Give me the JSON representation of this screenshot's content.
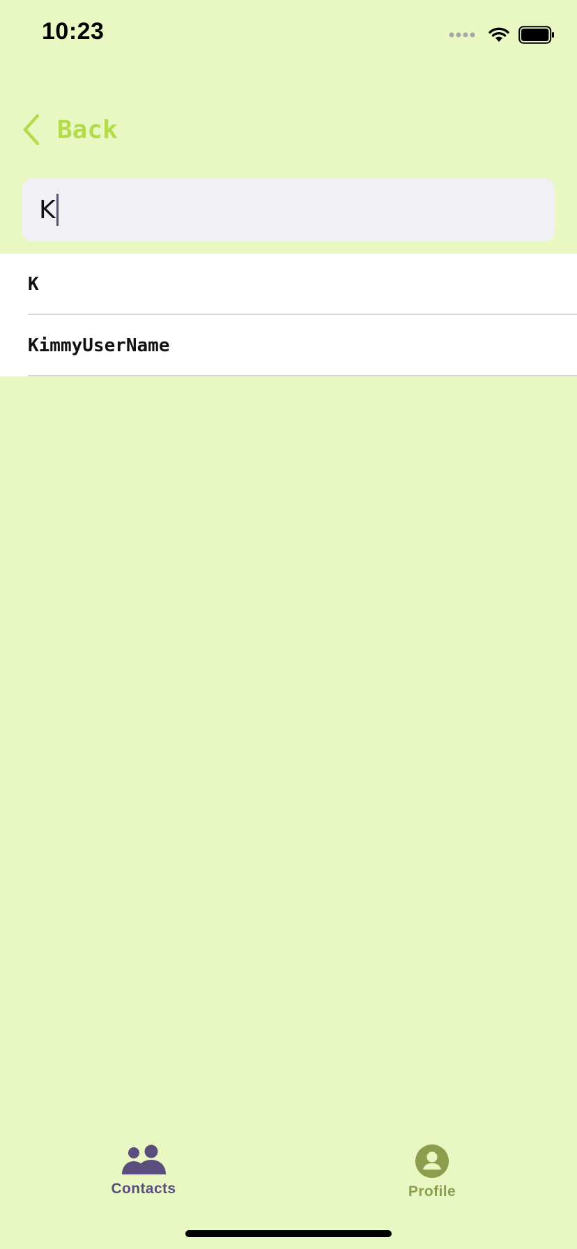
{
  "status_bar": {
    "time": "10:23"
  },
  "navigation": {
    "back_label": "Back"
  },
  "search": {
    "value": "K"
  },
  "results": [
    {
      "label": "K"
    },
    {
      "label": "KimmyUserName"
    }
  ],
  "tab_bar": {
    "tabs": [
      {
        "label": "Contacts",
        "icon": "contacts-icon",
        "selected": true
      },
      {
        "label": "Profile",
        "icon": "profile-icon",
        "selected": false
      }
    ]
  },
  "colors": {
    "background": "#e9f8c3",
    "accent": "#b4db4c",
    "tab_selected": "#5b4d7e",
    "tab_unselected": "#8c9e4d",
    "search_field": "#f1f0f5"
  }
}
